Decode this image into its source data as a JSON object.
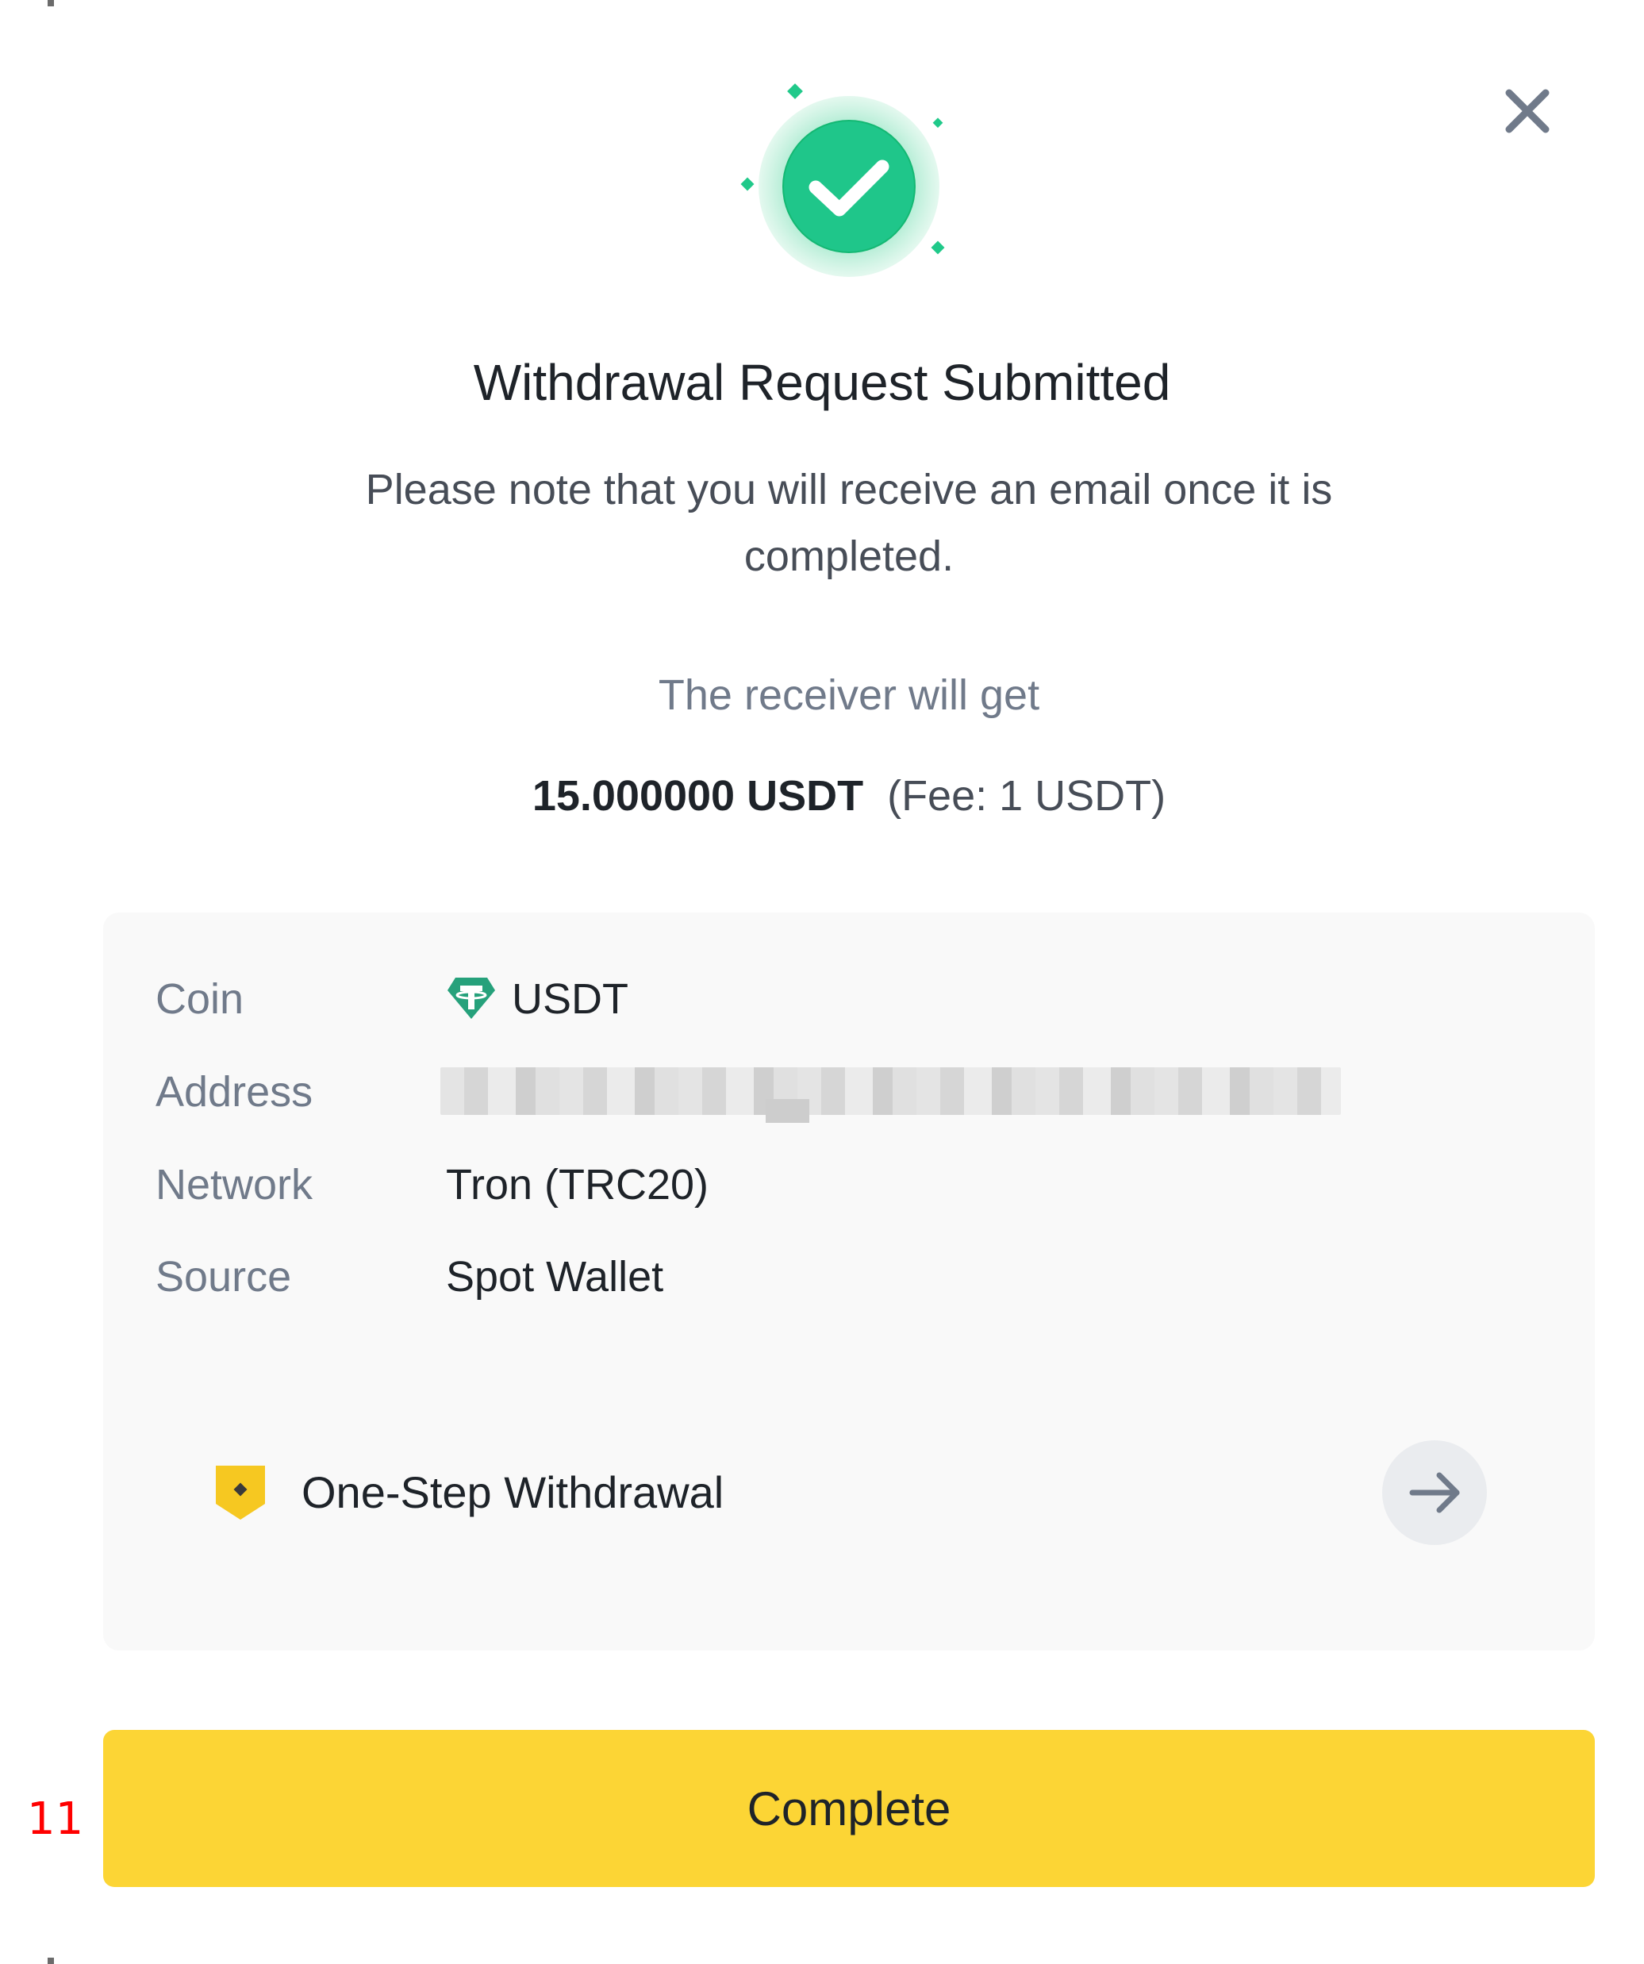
{
  "dialog": {
    "title": "Withdrawal Request Submitted",
    "subtitle": "Please note that you will receive an email once it is completed.",
    "receiver_label": "The receiver will get",
    "amount": "15.000000 USDT",
    "fee": "(Fee: 1 USDT)",
    "close_icon": "close-icon",
    "success_icon": "check-circle-icon"
  },
  "details": {
    "coin": {
      "label": "Coin",
      "value": "USDT",
      "icon": "tether-icon"
    },
    "address": {
      "label": "Address"
    },
    "network": {
      "label": "Network",
      "value": "Tron (TRC20)"
    },
    "source": {
      "label": "Source",
      "value": "Spot Wallet"
    }
  },
  "promo": {
    "label": "One-Step Withdrawal",
    "icon": "shield-icon",
    "arrow_icon": "arrow-right-icon"
  },
  "actions": {
    "complete_label": "Complete"
  },
  "annotation": {
    "step_number": "11"
  },
  "colors": {
    "accent": "#FCD535",
    "success": "#20C98A",
    "tether": "#26A17B",
    "text_primary": "#1E2329",
    "text_secondary": "#707A8A",
    "card_background": "#F9F9F9"
  }
}
